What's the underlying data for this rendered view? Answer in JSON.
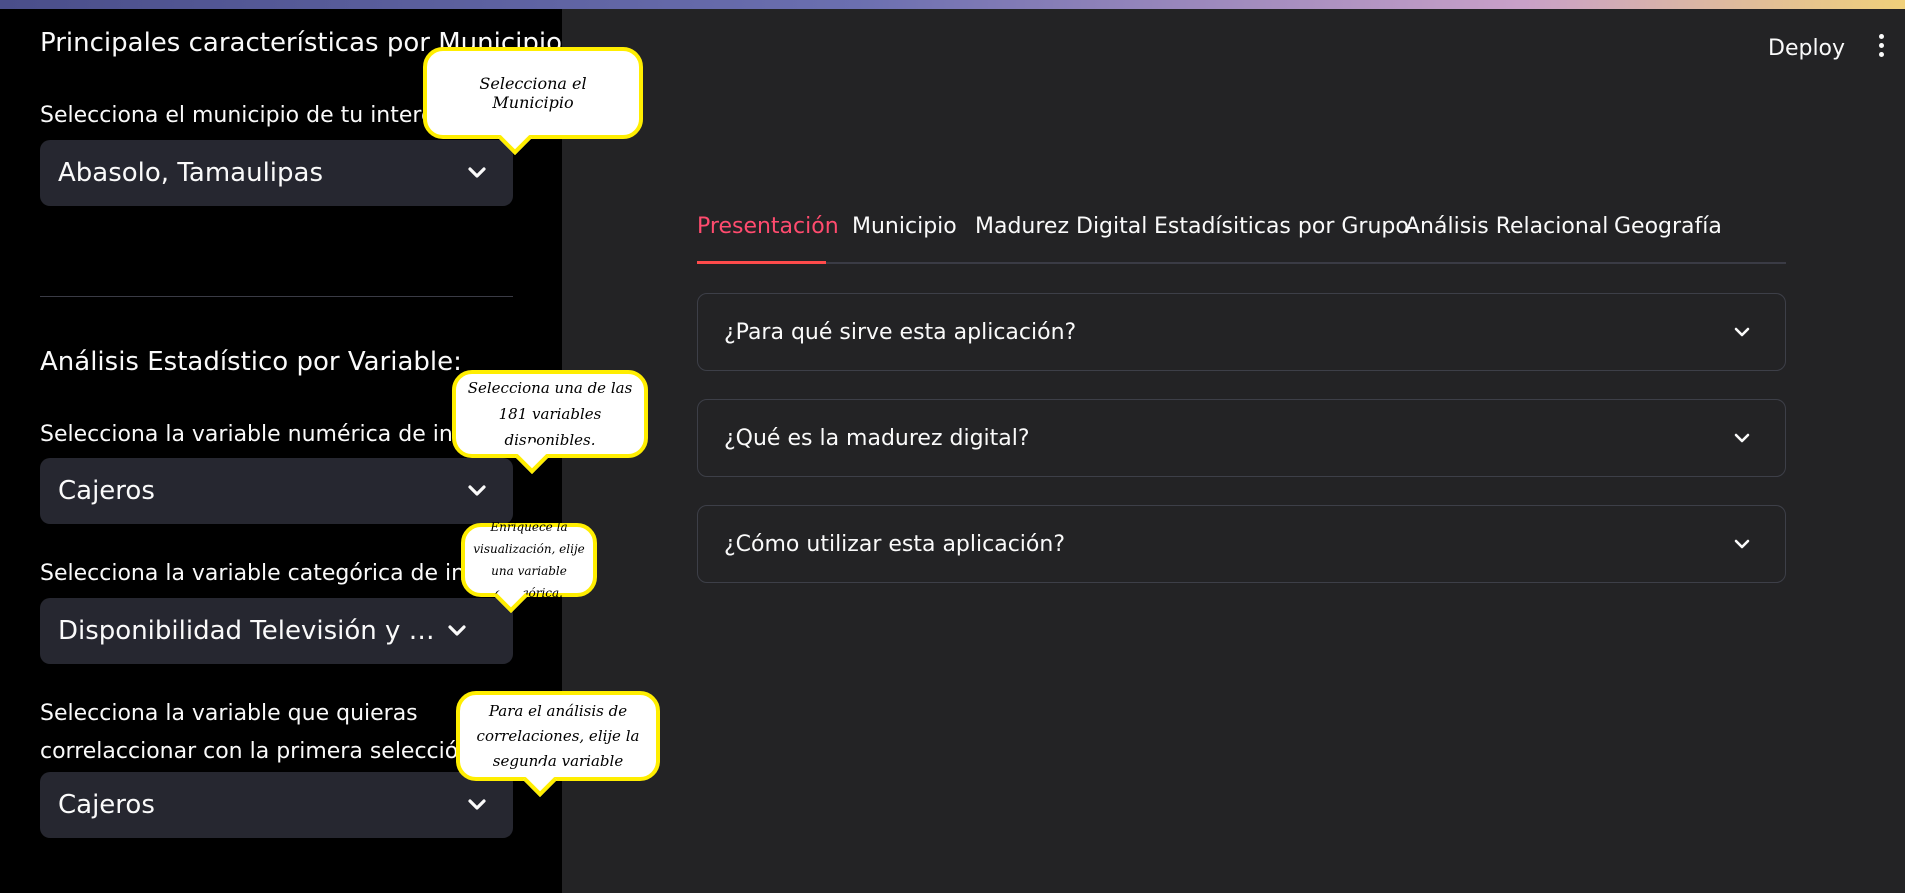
{
  "sidebar": {
    "section1_title": "Principales características por Municipio:",
    "municipio_label": "Selecciona el municipio de tu interés:",
    "municipio_value": "Abasolo, Tamaulipas",
    "section2_title": "Análisis Estadístico por Variable:",
    "numeric_label": "Selecciona la variable numérica de interés:",
    "numeric_value": "Cajeros",
    "categorical_label": "Selecciona la variable categórica de interés:",
    "categorical_value": "Disponibilidad Televisión y Audio",
    "correlation_label_line1": "Selecciona la variable que quieras",
    "correlation_label_line2": "correlaccionar con la primera selección:",
    "correlation_value": "Cajeros"
  },
  "callouts": {
    "municipio": "Selecciona el Municipio",
    "numeric": "Selecciona una de las 181 variables disponibles.",
    "categorical": "Enriquece la visualización, elije una variable categórica.",
    "correlation": "Para el análisis de correlaciones, elije la segunda variable"
  },
  "header": {
    "deploy_label": "Deploy",
    "menu_icon": "kebab-menu-icon"
  },
  "tabs": [
    {
      "label": "Presentación",
      "active": true
    },
    {
      "label": "Municipio",
      "active": false
    },
    {
      "label": "Madurez Digital",
      "active": false
    },
    {
      "label": "Estadísiticas por Grupo",
      "active": false
    },
    {
      "label": "Análisis Relacional",
      "active": false
    },
    {
      "label": "Geografía",
      "active": false
    }
  ],
  "expanders": [
    {
      "title": "¿Para qué sirve esta aplicación?"
    },
    {
      "title": "¿Qué es la madurez digital?"
    },
    {
      "title": "¿Cómo utilizar esta aplicación?"
    }
  ],
  "colors": {
    "accent": "#ff4b4b",
    "callout_border": "#ffee00",
    "sidebar_bg": "#000000",
    "main_bg": "#232325"
  }
}
